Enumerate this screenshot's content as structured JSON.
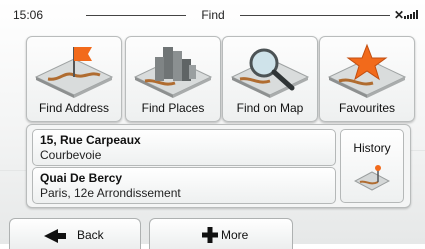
{
  "status": {
    "time": "15:06",
    "title": "Find",
    "icons": [
      "satellite-icon",
      "signal-strength-icon"
    ]
  },
  "tiles": [
    {
      "label": "Find Address",
      "icon": "flag-road-icon"
    },
    {
      "label": "Find Places",
      "icon": "buildings-icon"
    },
    {
      "label": "Find on Map",
      "icon": "magnifier-map-icon"
    },
    {
      "label": "Favourites",
      "icon": "star-icon"
    }
  ],
  "recent": [
    {
      "name": "15, Rue Carpeaux",
      "subtitle": "Courbevoie"
    },
    {
      "name": "Quai De Bercy",
      "subtitle": "Paris, 12e Arrondissement"
    }
  ],
  "history": {
    "label": "History",
    "icon": "history-route-icon"
  },
  "bottom": {
    "back_label": "Back",
    "more_label": "More"
  },
  "colors": {
    "accent_orange": "#f26a1b",
    "tile_border": "#b9bcbc"
  }
}
